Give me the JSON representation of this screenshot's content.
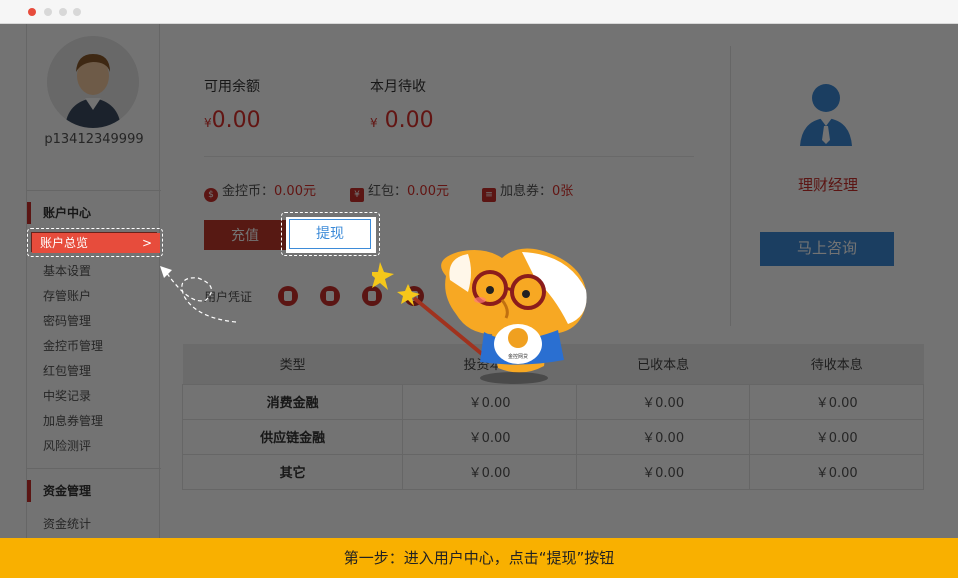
{
  "window": {
    "dots": [
      "#e74c3c",
      "#d8d8d8",
      "#d8d8d8",
      "#d8d8d8"
    ]
  },
  "sidebar": {
    "username": "p13412349999",
    "section1_title": "账户中心",
    "active_item": "账户总览",
    "active_chevron": ">",
    "items1": [
      "基本设置",
      "存管账户",
      "密码管理",
      "金控币管理",
      "红包管理",
      "中奖记录",
      "加息券管理",
      "风险测评"
    ],
    "section2_title": "资金管理",
    "items2": [
      "资金统计"
    ]
  },
  "summary": {
    "available_label": "可用余额",
    "available_currency": "¥",
    "available_value": "0.00",
    "pending_label": "本月待收",
    "pending_currency": "¥",
    "pending_value": "0.00"
  },
  "coupons": {
    "coin_label": "金控币：",
    "coin_value": "0.00元",
    "redpack_label": "红包：",
    "redpack_value": "0.00元",
    "interest_label": "加息券：",
    "interest_value": "0张"
  },
  "buttons": {
    "recharge": "充值",
    "withdraw": "提现"
  },
  "verify": {
    "label": "用户凭证"
  },
  "manager": {
    "title": "理财经理",
    "consult": "马上咨询"
  },
  "table": {
    "headers": [
      "类型",
      "投资本金",
      "已收本息",
      "待收本息"
    ],
    "rows": [
      [
        "消费金融",
        "￥0.00",
        "￥0.00",
        "￥0.00"
      ],
      [
        "供应链金融",
        "￥0.00",
        "￥0.00",
        "￥0.00"
      ],
      [
        "其它",
        "￥0.00",
        "￥0.00",
        "￥0.00"
      ]
    ]
  },
  "mascot": {
    "badge_text": "金控网贷"
  },
  "footer": {
    "text": "第一步：进入用户中心，点击“提现”按钮"
  },
  "colors": {
    "accent_red": "#c9302c",
    "accent_blue": "#3d8bd8",
    "footer_yellow": "#f9b000"
  }
}
